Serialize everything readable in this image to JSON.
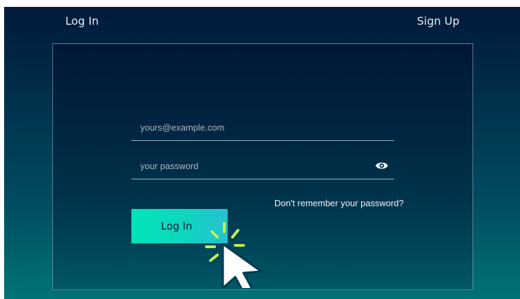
{
  "nav": {
    "login_label": "Log In",
    "signup_label": "Sign Up"
  },
  "form": {
    "email_placeholder": "yours@example.com",
    "password_placeholder": "your password",
    "forgot_link": "Don't remember your password?",
    "submit_label": "Log In"
  },
  "icons": {
    "password_toggle": "eye-icon",
    "pointer": "cursor-icon"
  },
  "colors": {
    "background_top": "#001a3a",
    "background_bottom": "#007378",
    "button_gradient_start": "#00e4b8",
    "button_gradient_end": "#26c0d2",
    "cursor_highlight": "#c8ee4a"
  }
}
